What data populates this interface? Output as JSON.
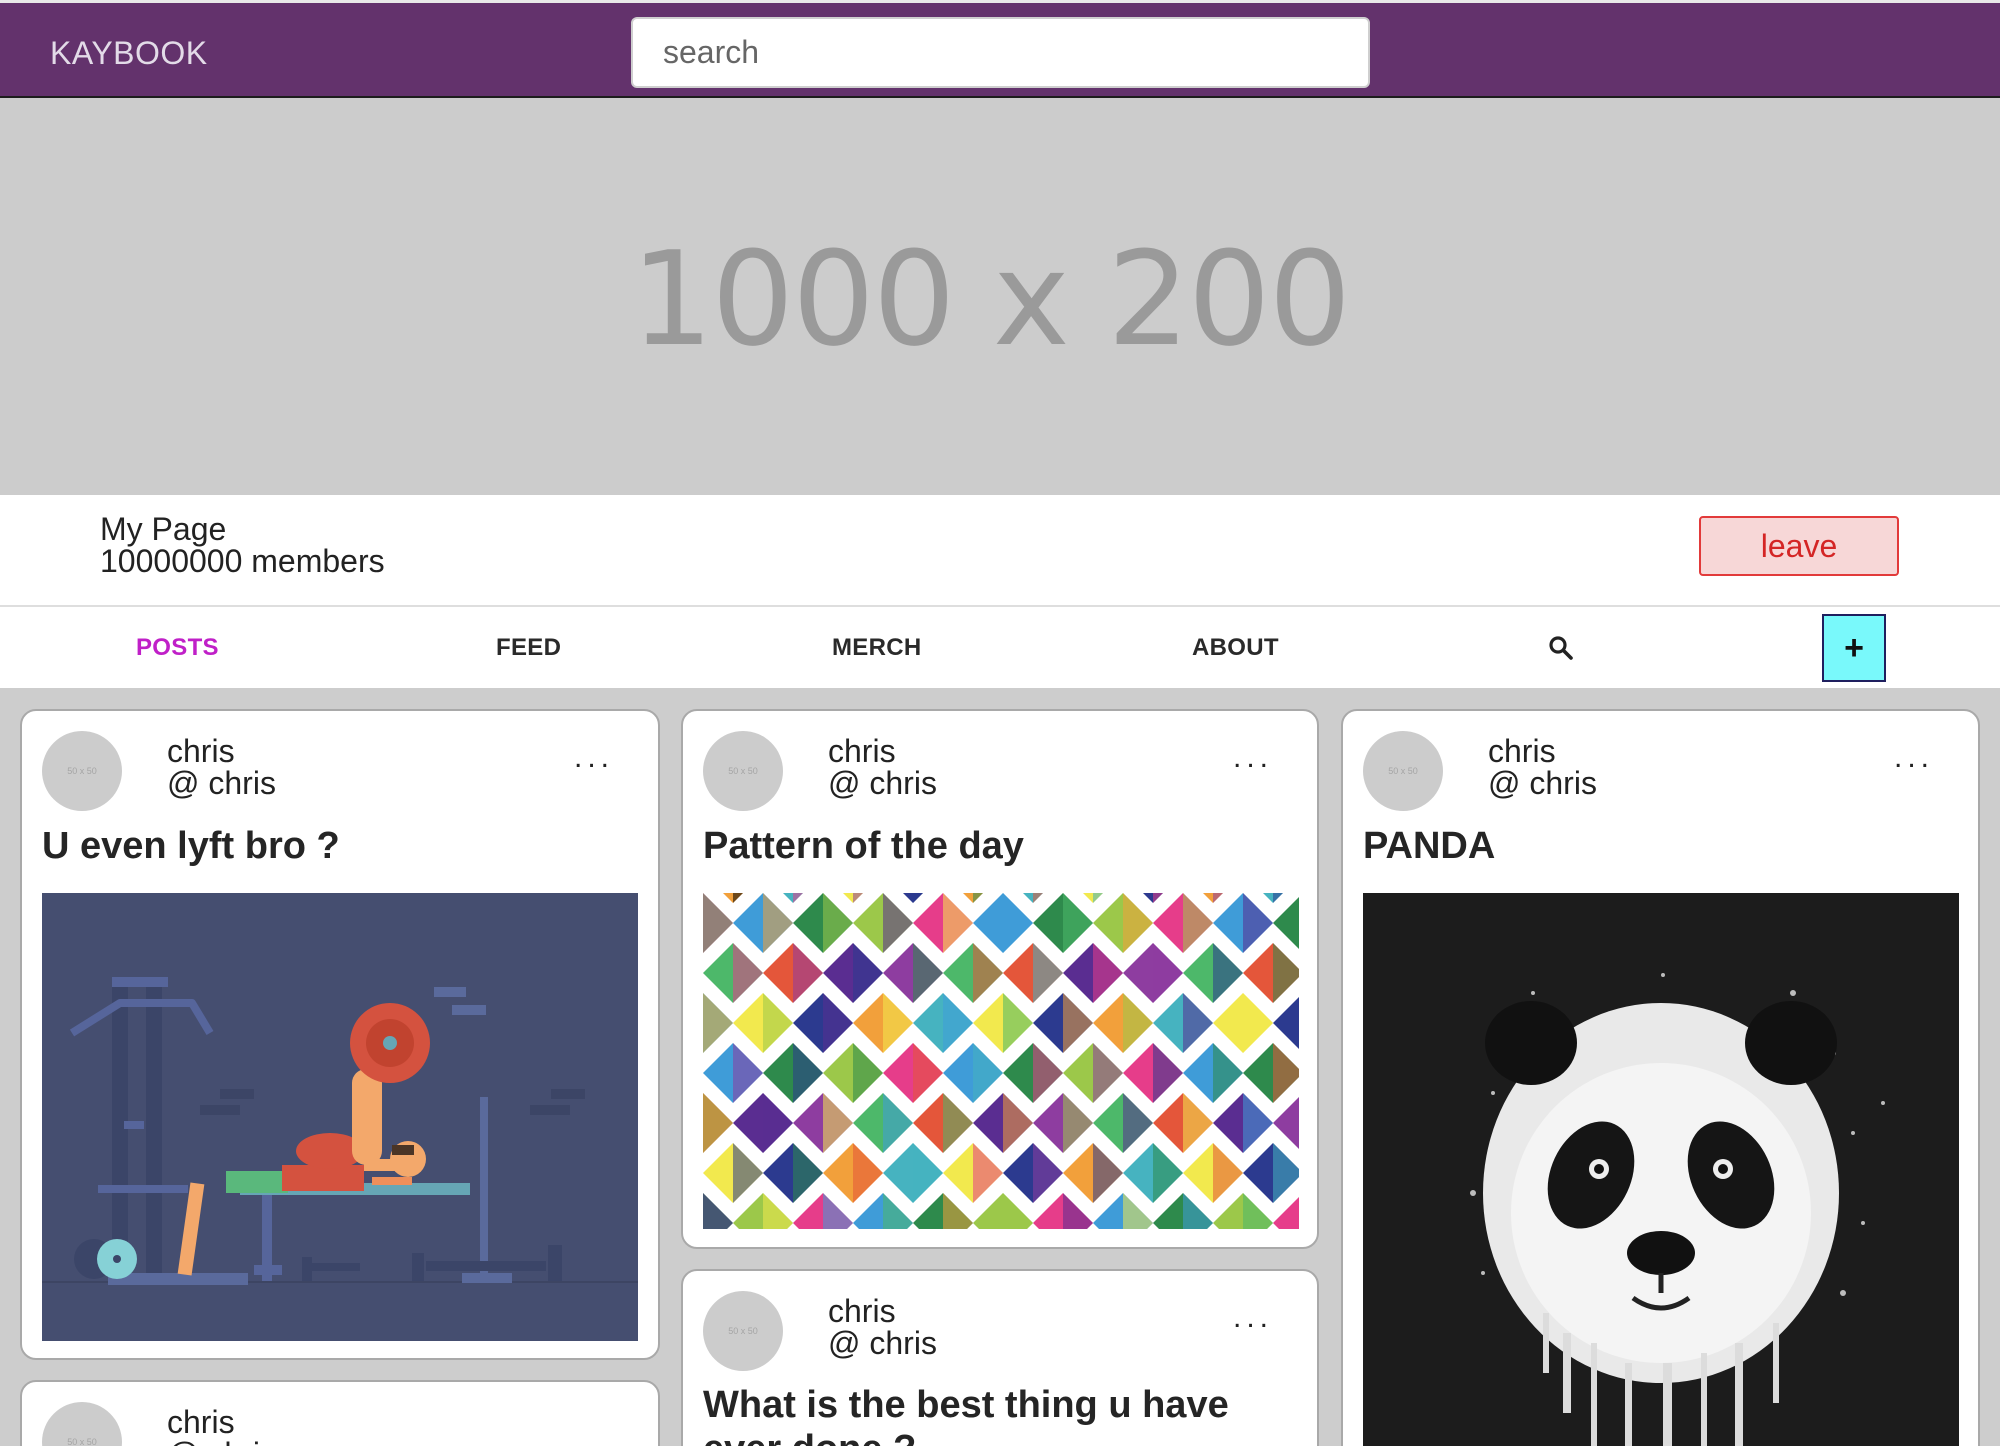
{
  "header": {
    "brand": "KAYBOOK",
    "search_placeholder": "search"
  },
  "banner": {
    "text": "1000 x 200"
  },
  "group": {
    "name": "My Page",
    "members": "10000000 members",
    "leave_label": "leave"
  },
  "tabs": [
    {
      "label": "POSTS",
      "active": true
    },
    {
      "label": "FEED"
    },
    {
      "label": "MERCH"
    },
    {
      "label": "ABOUT"
    }
  ],
  "tab_icons": {
    "search": "search-icon",
    "add": "+"
  },
  "posts": [
    {
      "avatar": "50 x 50",
      "user": "chris",
      "handle": "@ chris",
      "more": "...",
      "title": "U even lyft bro ?",
      "image": "gym-illustration"
    },
    {
      "avatar": "50 x 50",
      "user": "chris",
      "handle": "@ chris",
      "more": "...",
      "title": "Pattern of the day",
      "image": "color-pattern"
    },
    {
      "avatar": "50 x 50",
      "user": "chris",
      "handle": "@ chris",
      "more": "...",
      "title": "PANDA",
      "image": "panda-art"
    },
    {
      "avatar": "50 x 50",
      "user": "chris",
      "handle": "@ chris",
      "more": "...",
      "title": "What is the best thing u have ever done ?"
    },
    {
      "avatar": "50 x 50",
      "user": "chris",
      "handle": "@ chris"
    }
  ],
  "colors": {
    "topbar": "#63326c",
    "active_tab": "#c020c8",
    "leave_border": "#e23a3a",
    "add_button": "#79f9fb"
  }
}
